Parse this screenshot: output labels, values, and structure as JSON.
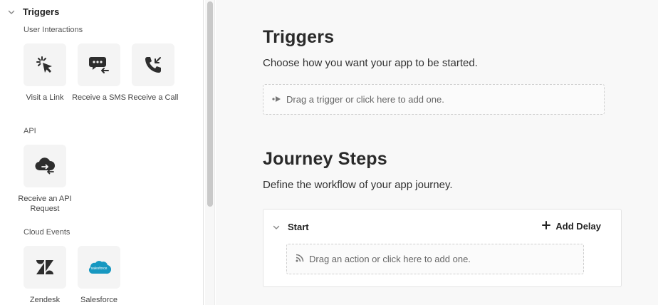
{
  "sidebar": {
    "title": "Triggers",
    "sections": {
      "user_interactions": {
        "label": "User Interactions",
        "items": [
          {
            "label": "Visit a Link",
            "icon": "cursor-click-icon"
          },
          {
            "label": "Receive a SMS",
            "icon": "sms-incoming-icon"
          },
          {
            "label": "Receive a Call",
            "icon": "phone-incoming-icon"
          }
        ]
      },
      "api": {
        "label": "API",
        "items": [
          {
            "label": "Receive an API Request",
            "icon": "cloud-transfer-icon"
          }
        ]
      },
      "cloud_events": {
        "label": "Cloud Events",
        "items": [
          {
            "label": "Zendesk",
            "icon": "zendesk-logo-icon"
          },
          {
            "label": "Salesforce",
            "icon": "salesforce-logo-icon",
            "logo_text": "salesforce",
            "color": "#1798c1"
          }
        ]
      }
    }
  },
  "main": {
    "triggers": {
      "title": "Triggers",
      "subtitle": "Choose how you want your app to be started.",
      "dropzone": "Drag a trigger or click here to add one."
    },
    "journey": {
      "title": "Journey Steps",
      "subtitle": "Define the workflow of your app journey.",
      "start_label": "Start",
      "add_delay_label": "Add Delay",
      "dropzone": "Drag an action or click here to add one."
    }
  }
}
